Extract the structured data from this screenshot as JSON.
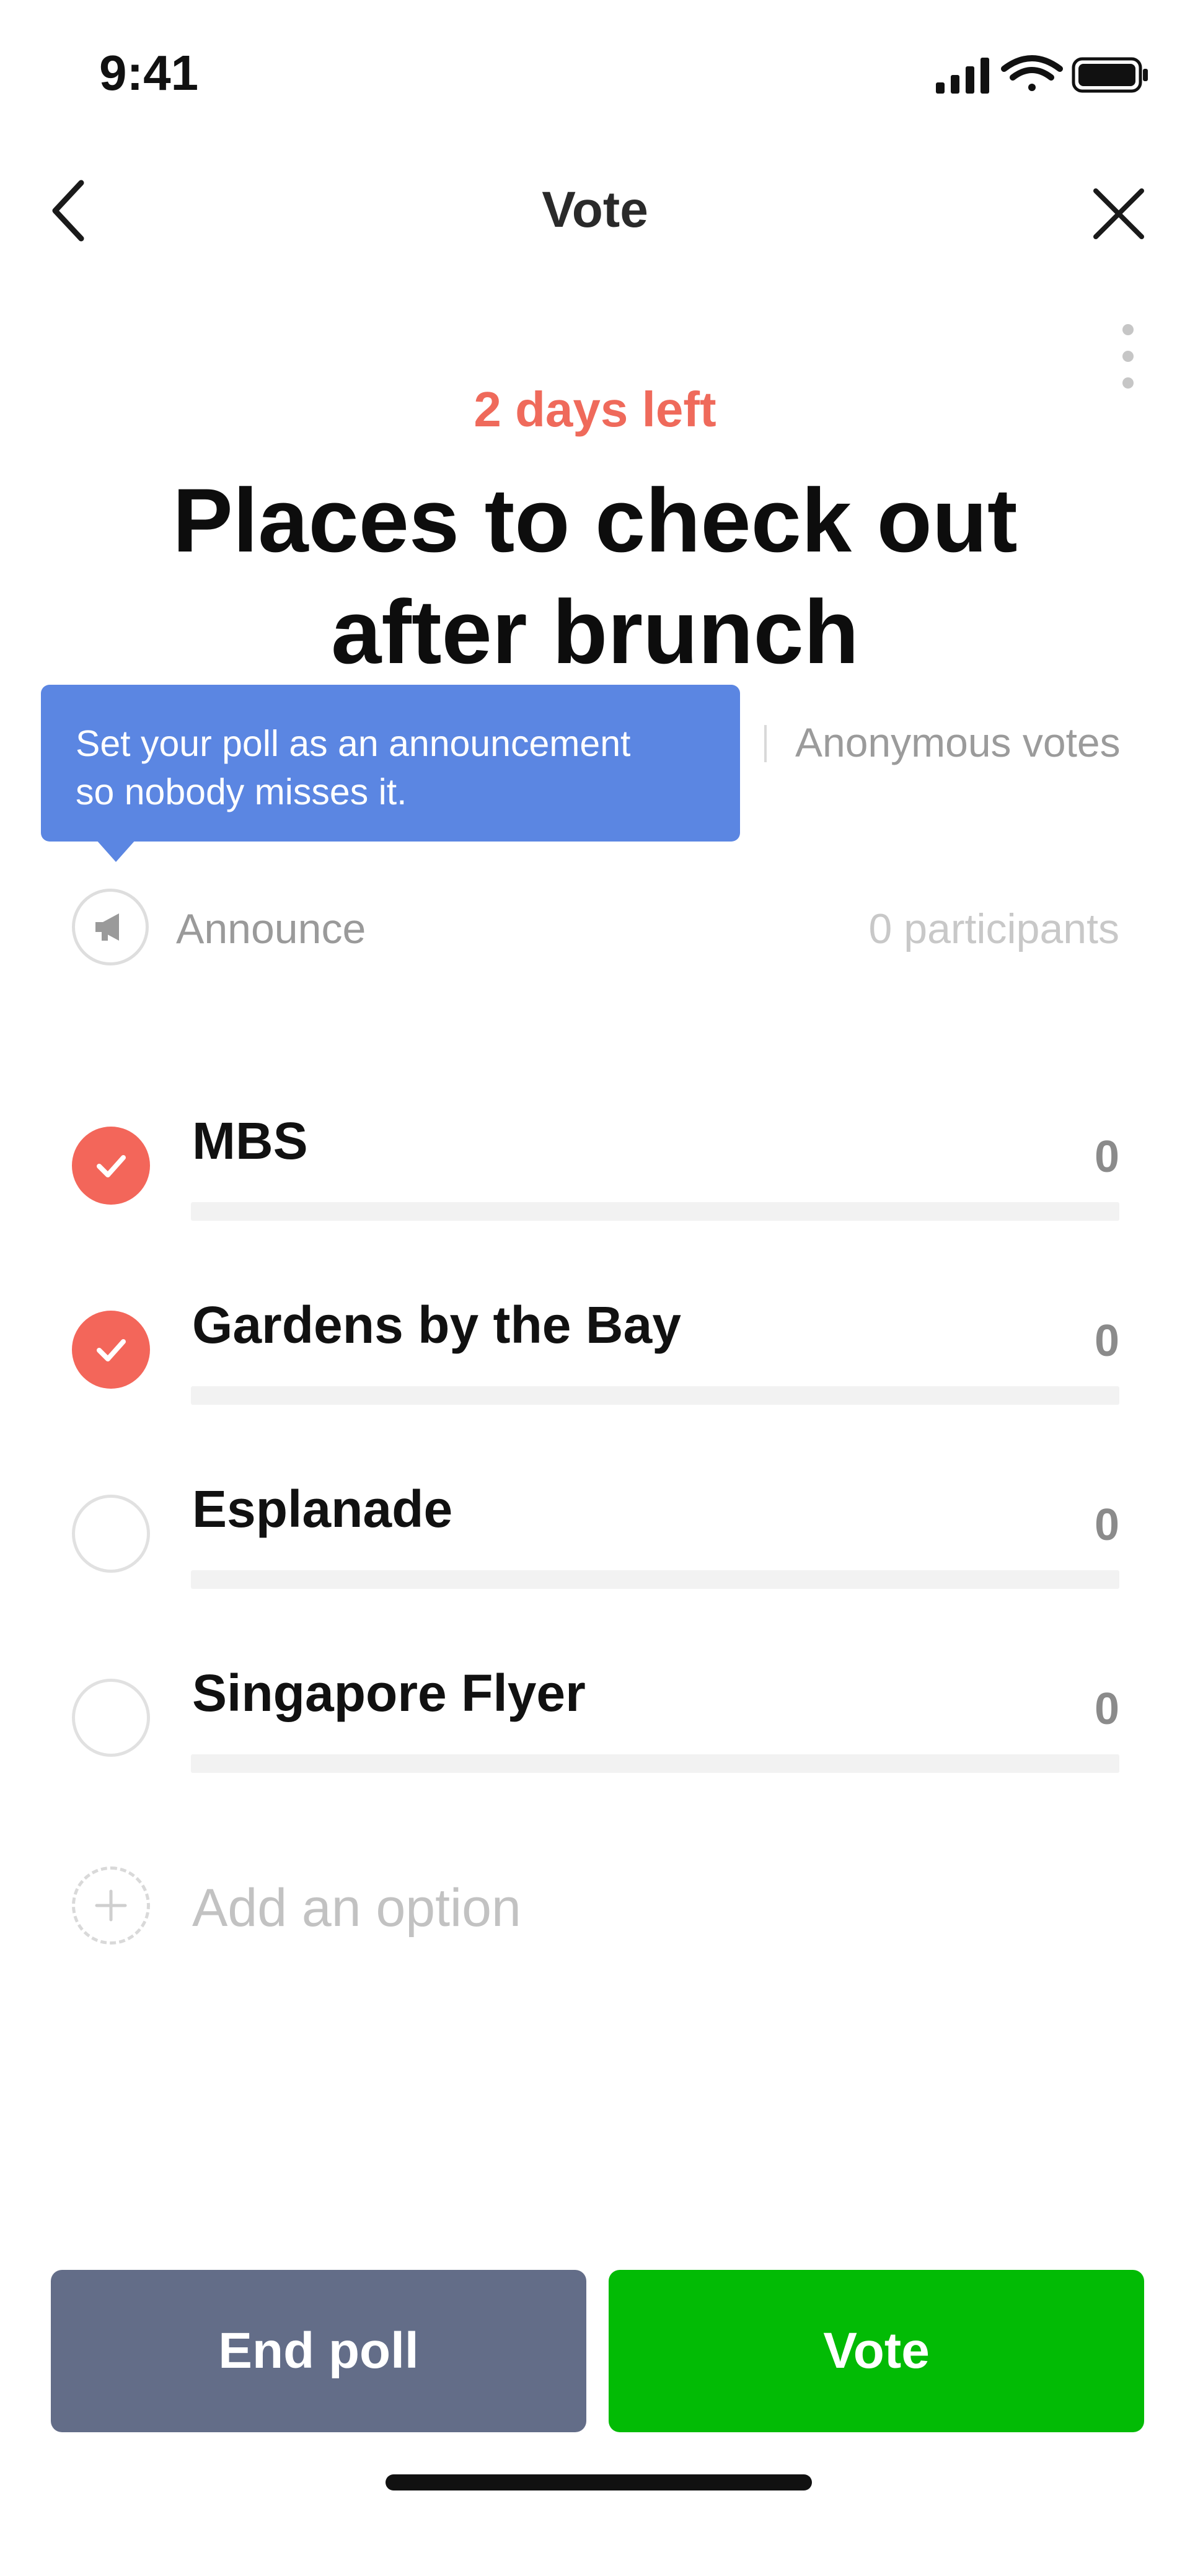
{
  "status_bar": {
    "time": "9:41"
  },
  "nav": {
    "title": "Vote"
  },
  "poll": {
    "deadline": "2 days left",
    "title_line1": "Places to check out",
    "title_line2": "after brunch",
    "anonymous_label": "Anonymous votes",
    "tooltip_line1": "Set your poll as an announcement",
    "tooltip_line2": "so nobody misses it.",
    "announce_label": "Announce",
    "participants": "0 participants",
    "add_option_placeholder": "Add an option",
    "options": [
      {
        "label": "MBS",
        "count": "0",
        "selected": true,
        "share": 0
      },
      {
        "label": "Gardens by the Bay",
        "count": "0",
        "selected": true,
        "share": 0
      },
      {
        "label": "Esplanade",
        "count": "0",
        "selected": false,
        "share": 0
      },
      {
        "label": "Singapore Flyer",
        "count": "0",
        "selected": false,
        "share": 0
      }
    ]
  },
  "actions": {
    "end_poll": "End poll",
    "vote": "Vote"
  },
  "colors": {
    "accent_red": "#f3665a",
    "deadline_red": "#ef6a5b",
    "tooltip_blue": "#5b86e2",
    "end_button": "#636d88",
    "vote_button": "#02bb05"
  },
  "icons": [
    "back-chevron-icon",
    "close-icon",
    "more-vertical-icon",
    "megaphone-icon",
    "check-icon",
    "plus-icon",
    "signal-icon",
    "wifi-icon",
    "battery-icon"
  ]
}
